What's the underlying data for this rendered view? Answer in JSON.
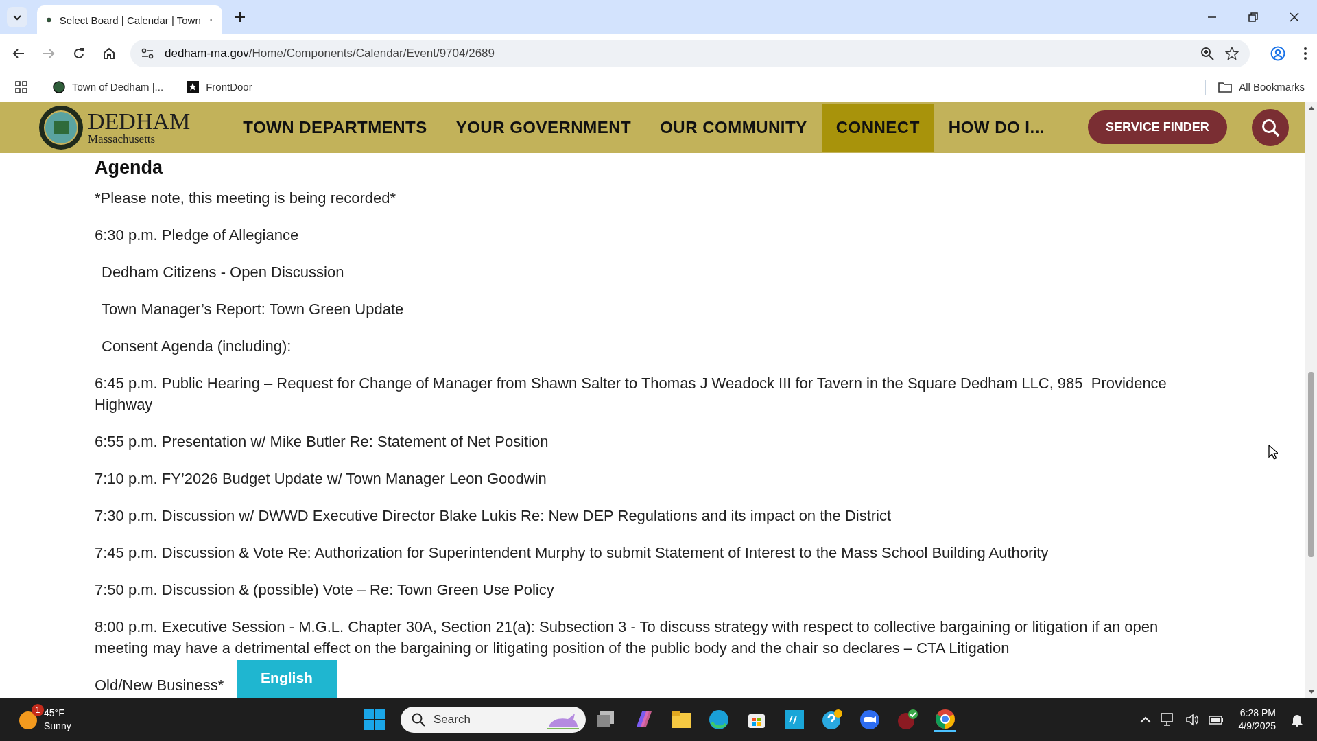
{
  "browser": {
    "tabs": [
      {
        "title": "Select Board | Calendar | Town",
        "selected": true
      }
    ],
    "url_host": "dedham-ma.gov",
    "url_path": "/Home/Components/Calendar/Event/9704/2689",
    "bookmarks": [
      {
        "label": "Town of Dedham |...",
        "kind": "seal"
      },
      {
        "label": "FrontDoor",
        "kind": "star"
      }
    ],
    "all_bookmarks": "All Bookmarks"
  },
  "site": {
    "title": "DEDHAM",
    "subtitle": "Massachusetts",
    "nav": [
      {
        "label": "TOWN DEPARTMENTS",
        "selected": false
      },
      {
        "label": "YOUR GOVERNMENT",
        "selected": false
      },
      {
        "label": "OUR COMMUNITY",
        "selected": false
      },
      {
        "label": "CONNECT",
        "selected": true
      },
      {
        "label": "HOW DO I...",
        "selected": false
      }
    ],
    "service_finder": "SERVICE FINDER"
  },
  "agenda": {
    "heading": "Agenda",
    "items": [
      {
        "text": "*Please note, this meeting is being recorded*",
        "indent": false
      },
      {
        "text": "6:30 p.m. Pledge of Allegiance",
        "indent": false
      },
      {
        "text": "Dedham Citizens - Open Discussion",
        "indent": true
      },
      {
        "text": "Town Manager’s Report: Town Green Update",
        "indent": true
      },
      {
        "text": "Consent Agenda (including):",
        "indent": true
      },
      {
        "text": "6:45 p.m. Public Hearing – Request for Change of Manager from Shawn Salter to Thomas J Weadock III for Tavern in the Square Dedham LLC, 985  Providence Highway",
        "indent": false
      },
      {
        "text": "6:55 p.m. Presentation w/ Mike Butler Re: Statement of Net Position",
        "indent": false
      },
      {
        "text": "7:10 p.m. FY’2026 Budget Update w/ Town Manager Leon Goodwin",
        "indent": false
      },
      {
        "text": "7:30 p.m. Discussion w/ DWWD Executive Director Blake Lukis Re: New DEP Regulations and its impact on the District",
        "indent": false
      },
      {
        "text": "7:45 p.m. Discussion & Vote Re: Authorization for Superintendent Murphy to submit Statement of Interest to the Mass School Building Authority",
        "indent": false
      },
      {
        "text": "7:50 p.m. Discussion & (possible) Vote – Re: Town Green Use Policy",
        "indent": false
      },
      {
        "text": "8:00 p.m. Executive Session - M.G.L. Chapter 30A, Section 21(a): Subsection 3 - To discuss strategy with respect to collective bargaining or litigation if an open meeting may have a detrimental effect on the bargaining or litigating position of the public body and the chair so declares – CTA Litigation",
        "indent": false
      },
      {
        "text": "Old/New Business*",
        "indent": false
      }
    ],
    "language_button": "English"
  },
  "taskbar": {
    "weather": {
      "badge": "1",
      "temperature": "45°F",
      "condition": "Sunny"
    },
    "search_placeholder": "Search",
    "time": "6:28 PM",
    "date": "4/9/2025"
  }
}
